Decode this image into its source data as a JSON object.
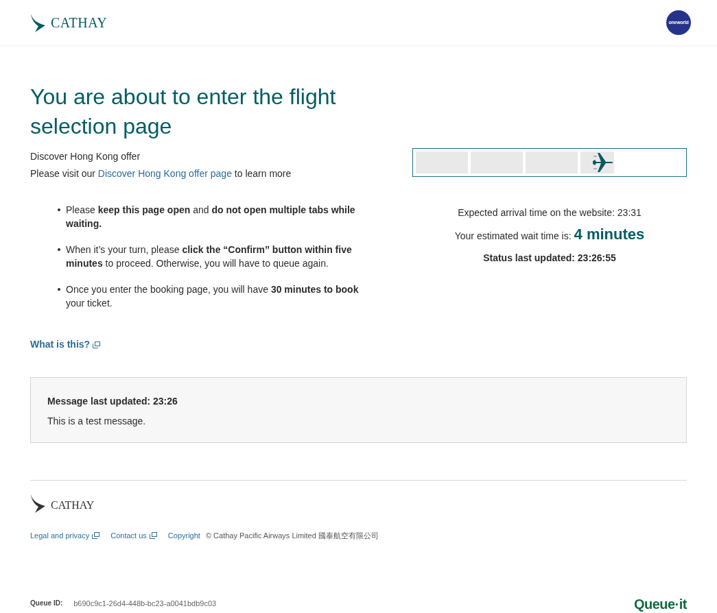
{
  "header": {
    "logo_text": "CATHAY",
    "alliance_badge": "oneworld"
  },
  "title": "You are about to enter the flight selection page",
  "offer": {
    "heading": "Discover Hong Kong offer",
    "text_before": "Please visit our",
    "link": "Discover Hong Kong offer page",
    "text_after": "to learn more"
  },
  "bullets": [
    "Please **keep this page open** and **do not open multiple tabs while waiting.**",
    "When it’s your turn, please **click the “Confirm” button within five minutes** to proceed. Otherwise, you will have to queue again.",
    "Once you enter the booking page, you will have **30 minutes to book** your ticket."
  ],
  "help_link": "What is this?",
  "progress": {
    "level": 0.74
  },
  "expected_arrival": "Expected arrival time on the website: 23:31",
  "wait_label": "Your estimated wait time is:",
  "wait_value": "4 minutes",
  "status_updated": "Status last updated: 23:26:55",
  "message": {
    "heading": "Message last updated: 23:26",
    "text": "This is a test message."
  },
  "footer": {
    "logo_text": "CATHAY",
    "links": [
      "Legal and privacy",
      "Contact us",
      "Copyright"
    ],
    "copyright": "© Cathay Pacific Airways Limited 國泰航空有限公司"
  },
  "queue": {
    "label": "Queue ID:",
    "id": "b690c9c1-26d4-448b-bc23-a0041bdb9c03",
    "brand": "Queue·it"
  }
}
